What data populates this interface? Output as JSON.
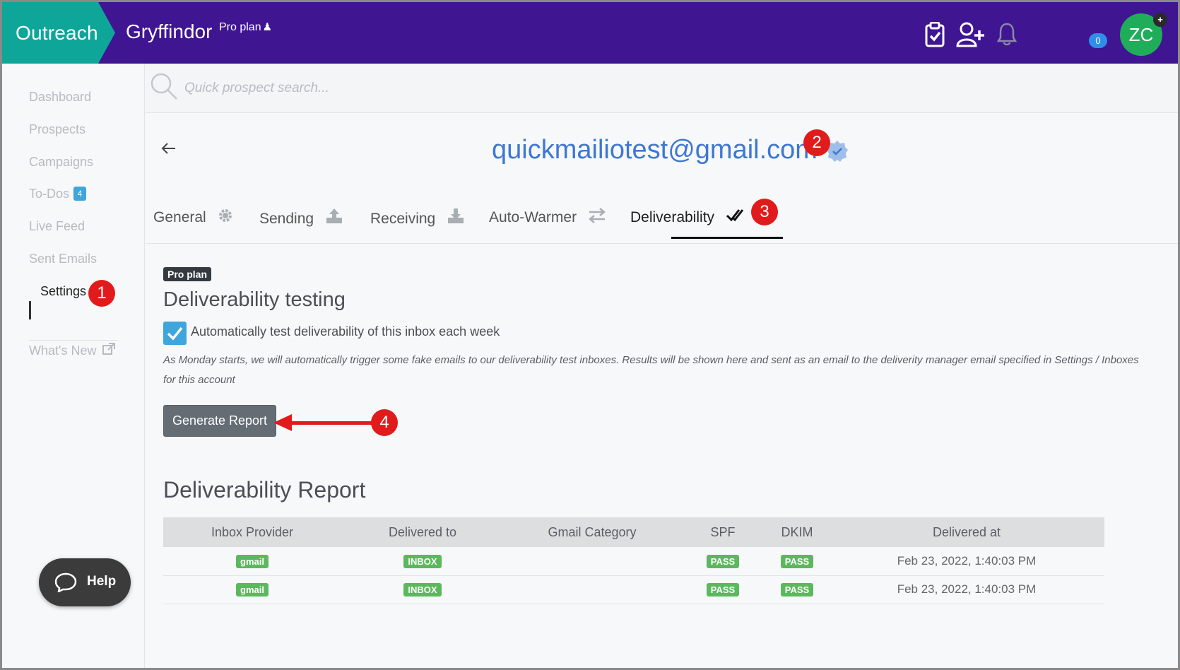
{
  "header": {
    "brand": "Outreach",
    "team": "Gryffindor",
    "plan": "Pro plan",
    "notification_count": "0",
    "avatar_initials": "ZC",
    "avatar_badge": "+",
    "colors": {
      "header_bg": "#3f1592",
      "brand_bg": "#0fa69a",
      "avatar_bg": "#20ad5a"
    }
  },
  "sidebar": {
    "items": [
      {
        "label": "Dashboard"
      },
      {
        "label": "Prospects"
      },
      {
        "label": "Campaigns"
      },
      {
        "label": "To-Dos",
        "badge": "4"
      },
      {
        "label": "Live Feed"
      },
      {
        "label": "Sent Emails"
      },
      {
        "label": "Settings",
        "active": true
      }
    ],
    "whats_new": "What's New",
    "help": "Help"
  },
  "search": {
    "placeholder": "Quick prospect search..."
  },
  "inbox": {
    "email": "quickmailiotest@gmail.com",
    "tabs": [
      {
        "label": "General",
        "icon": "gear-icon"
      },
      {
        "label": "Sending",
        "icon": "upload-icon"
      },
      {
        "label": "Receiving",
        "icon": "download-icon"
      },
      {
        "label": "Auto-Warmer",
        "icon": "swap-icon"
      },
      {
        "label": "Deliverability",
        "icon": "double-check-icon",
        "active": true
      }
    ]
  },
  "deliverability": {
    "badge": "Pro plan",
    "title": "Deliverability testing",
    "checkbox_label": "Automatically test deliverability of this inbox each week",
    "checkbox_checked": true,
    "note": "As Monday starts, we will automatically trigger some fake emails to our deliverability test inboxes. Results will be shown here and sent as an email to the deliverity manager email specified in Settings / Inboxes for this account",
    "generate_button": "Generate Report"
  },
  "report": {
    "title": "Deliverability Report",
    "columns": [
      "Inbox Provider",
      "Delivered to",
      "Gmail Category",
      "SPF",
      "DKIM",
      "Delivered at"
    ],
    "rows": [
      {
        "provider": "gmail",
        "delivered_to": "INBOX",
        "category": "",
        "spf": "PASS",
        "dkim": "PASS",
        "delivered_at": "Feb 23, 2022, 1:40:03 PM"
      },
      {
        "provider": "gmail",
        "delivered_to": "INBOX",
        "category": "",
        "spf": "PASS",
        "dkim": "PASS",
        "delivered_at": "Feb 23, 2022, 1:40:03 PM"
      }
    ]
  },
  "callouts": [
    "1",
    "2",
    "3",
    "4"
  ]
}
